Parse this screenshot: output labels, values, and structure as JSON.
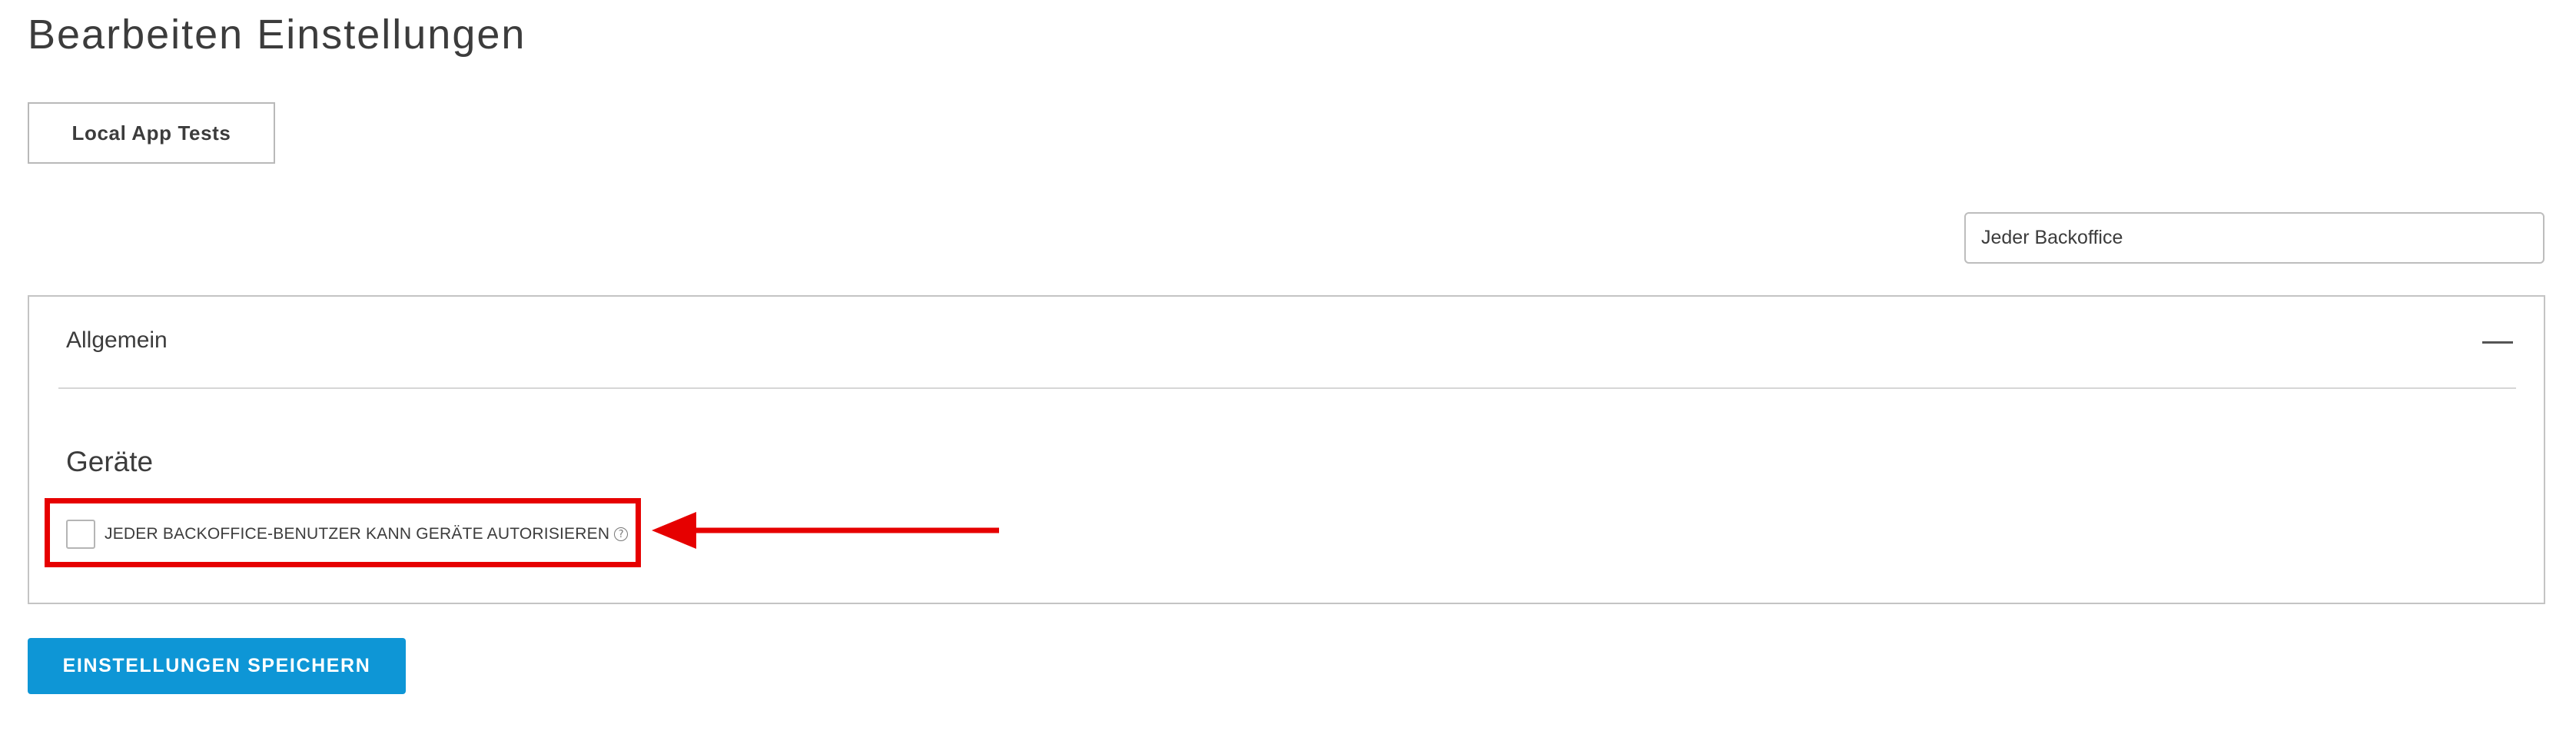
{
  "page": {
    "title": "Bearbeiten Einstellungen"
  },
  "tabs": [
    {
      "label": "Local App Tests"
    }
  ],
  "filter": {
    "value": "Jeder Backoffice",
    "placeholder": "Jeder Backoffice"
  },
  "panel": {
    "title": "Allgemein",
    "collapse_icon": "minus-icon",
    "section": {
      "heading": "Geräte",
      "checkbox": {
        "label": "JEDER BACKOFFICE-BENUTZER KANN GERÄTE AUTORISIEREN",
        "checked": false,
        "help_icon": "help-circle-icon",
        "help_glyph": "?"
      }
    }
  },
  "annotation": {
    "color": "#e60000",
    "highlight": "red-rectangle",
    "arrow": "red-arrow-left"
  },
  "actions": {
    "save_label": "EINSTELLUNGEN SPEICHERN",
    "save_color": "#0e96d6"
  }
}
